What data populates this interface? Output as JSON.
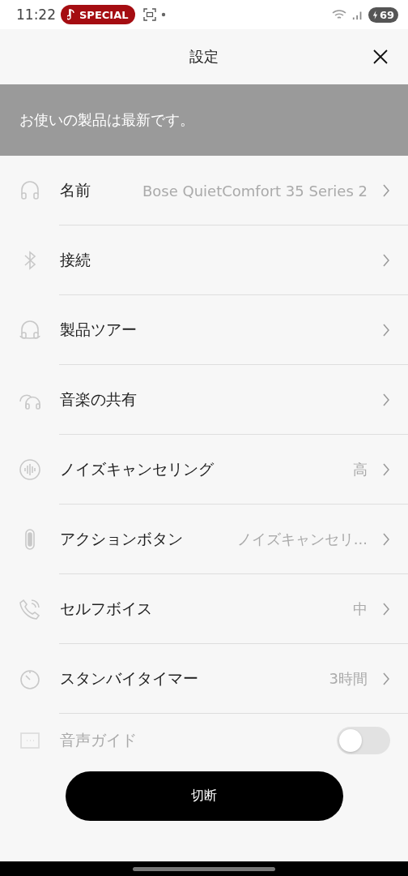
{
  "status_bar": {
    "time": "11:22",
    "media_chip": "SPECIAL",
    "battery": "69"
  },
  "header": {
    "title": "設定"
  },
  "banner": {
    "text": "お使いの製品は最新です。"
  },
  "settings": [
    {
      "kind": "link",
      "label": "名前",
      "value": "Bose QuietComfort 35 Series 2"
    },
    {
      "kind": "link",
      "label": "接続"
    },
    {
      "kind": "link",
      "label": "製品ツアー"
    },
    {
      "kind": "link",
      "label": "音楽の共有"
    },
    {
      "kind": "link",
      "label": "ノイズキャンセリング",
      "value": "高"
    },
    {
      "kind": "link",
      "label": "アクションボタン",
      "value": "ノイズキャンセリ..."
    },
    {
      "kind": "link",
      "label": "セルフボイス",
      "value": "中"
    },
    {
      "kind": "link",
      "label": "スタンバイタイマー",
      "value": "3時間"
    },
    {
      "kind": "toggle",
      "label": "音声ガイド",
      "disabled": true,
      "on": false
    }
  ],
  "disconnect_button": "切断"
}
